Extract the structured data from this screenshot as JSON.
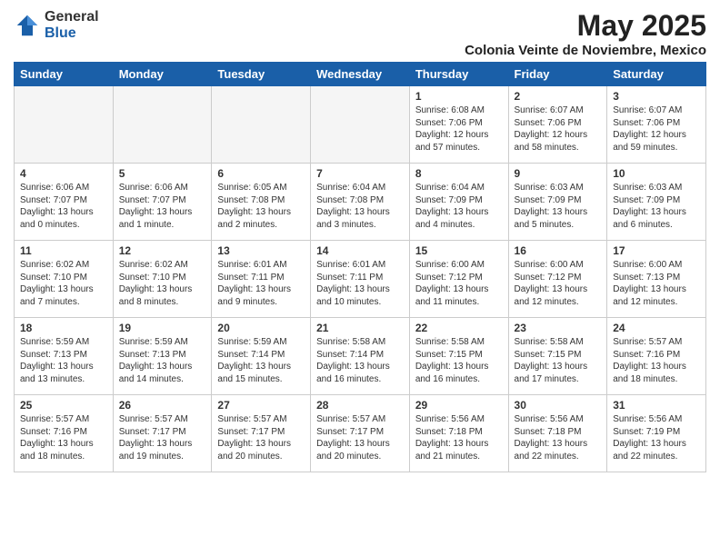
{
  "logo": {
    "general": "General",
    "blue": "Blue"
  },
  "title": {
    "month_year": "May 2025",
    "location": "Colonia Veinte de Noviembre, Mexico"
  },
  "headers": [
    "Sunday",
    "Monday",
    "Tuesday",
    "Wednesday",
    "Thursday",
    "Friday",
    "Saturday"
  ],
  "weeks": [
    [
      {
        "day": "",
        "text": "",
        "empty": true
      },
      {
        "day": "",
        "text": "",
        "empty": true
      },
      {
        "day": "",
        "text": "",
        "empty": true
      },
      {
        "day": "",
        "text": "",
        "empty": true
      },
      {
        "day": "1",
        "text": "Sunrise: 6:08 AM\nSunset: 7:06 PM\nDaylight: 12 hours\nand 57 minutes.",
        "empty": false
      },
      {
        "day": "2",
        "text": "Sunrise: 6:07 AM\nSunset: 7:06 PM\nDaylight: 12 hours\nand 58 minutes.",
        "empty": false
      },
      {
        "day": "3",
        "text": "Sunrise: 6:07 AM\nSunset: 7:06 PM\nDaylight: 12 hours\nand 59 minutes.",
        "empty": false
      }
    ],
    [
      {
        "day": "4",
        "text": "Sunrise: 6:06 AM\nSunset: 7:07 PM\nDaylight: 13 hours\nand 0 minutes.",
        "empty": false
      },
      {
        "day": "5",
        "text": "Sunrise: 6:06 AM\nSunset: 7:07 PM\nDaylight: 13 hours\nand 1 minute.",
        "empty": false
      },
      {
        "day": "6",
        "text": "Sunrise: 6:05 AM\nSunset: 7:08 PM\nDaylight: 13 hours\nand 2 minutes.",
        "empty": false
      },
      {
        "day": "7",
        "text": "Sunrise: 6:04 AM\nSunset: 7:08 PM\nDaylight: 13 hours\nand 3 minutes.",
        "empty": false
      },
      {
        "day": "8",
        "text": "Sunrise: 6:04 AM\nSunset: 7:09 PM\nDaylight: 13 hours\nand 4 minutes.",
        "empty": false
      },
      {
        "day": "9",
        "text": "Sunrise: 6:03 AM\nSunset: 7:09 PM\nDaylight: 13 hours\nand 5 minutes.",
        "empty": false
      },
      {
        "day": "10",
        "text": "Sunrise: 6:03 AM\nSunset: 7:09 PM\nDaylight: 13 hours\nand 6 minutes.",
        "empty": false
      }
    ],
    [
      {
        "day": "11",
        "text": "Sunrise: 6:02 AM\nSunset: 7:10 PM\nDaylight: 13 hours\nand 7 minutes.",
        "empty": false
      },
      {
        "day": "12",
        "text": "Sunrise: 6:02 AM\nSunset: 7:10 PM\nDaylight: 13 hours\nand 8 minutes.",
        "empty": false
      },
      {
        "day": "13",
        "text": "Sunrise: 6:01 AM\nSunset: 7:11 PM\nDaylight: 13 hours\nand 9 minutes.",
        "empty": false
      },
      {
        "day": "14",
        "text": "Sunrise: 6:01 AM\nSunset: 7:11 PM\nDaylight: 13 hours\nand 10 minutes.",
        "empty": false
      },
      {
        "day": "15",
        "text": "Sunrise: 6:00 AM\nSunset: 7:12 PM\nDaylight: 13 hours\nand 11 minutes.",
        "empty": false
      },
      {
        "day": "16",
        "text": "Sunrise: 6:00 AM\nSunset: 7:12 PM\nDaylight: 13 hours\nand 12 minutes.",
        "empty": false
      },
      {
        "day": "17",
        "text": "Sunrise: 6:00 AM\nSunset: 7:13 PM\nDaylight: 13 hours\nand 12 minutes.",
        "empty": false
      }
    ],
    [
      {
        "day": "18",
        "text": "Sunrise: 5:59 AM\nSunset: 7:13 PM\nDaylight: 13 hours\nand 13 minutes.",
        "empty": false
      },
      {
        "day": "19",
        "text": "Sunrise: 5:59 AM\nSunset: 7:13 PM\nDaylight: 13 hours\nand 14 minutes.",
        "empty": false
      },
      {
        "day": "20",
        "text": "Sunrise: 5:59 AM\nSunset: 7:14 PM\nDaylight: 13 hours\nand 15 minutes.",
        "empty": false
      },
      {
        "day": "21",
        "text": "Sunrise: 5:58 AM\nSunset: 7:14 PM\nDaylight: 13 hours\nand 16 minutes.",
        "empty": false
      },
      {
        "day": "22",
        "text": "Sunrise: 5:58 AM\nSunset: 7:15 PM\nDaylight: 13 hours\nand 16 minutes.",
        "empty": false
      },
      {
        "day": "23",
        "text": "Sunrise: 5:58 AM\nSunset: 7:15 PM\nDaylight: 13 hours\nand 17 minutes.",
        "empty": false
      },
      {
        "day": "24",
        "text": "Sunrise: 5:57 AM\nSunset: 7:16 PM\nDaylight: 13 hours\nand 18 minutes.",
        "empty": false
      }
    ],
    [
      {
        "day": "25",
        "text": "Sunrise: 5:57 AM\nSunset: 7:16 PM\nDaylight: 13 hours\nand 18 minutes.",
        "empty": false
      },
      {
        "day": "26",
        "text": "Sunrise: 5:57 AM\nSunset: 7:17 PM\nDaylight: 13 hours\nand 19 minutes.",
        "empty": false
      },
      {
        "day": "27",
        "text": "Sunrise: 5:57 AM\nSunset: 7:17 PM\nDaylight: 13 hours\nand 20 minutes.",
        "empty": false
      },
      {
        "day": "28",
        "text": "Sunrise: 5:57 AM\nSunset: 7:17 PM\nDaylight: 13 hours\nand 20 minutes.",
        "empty": false
      },
      {
        "day": "29",
        "text": "Sunrise: 5:56 AM\nSunset: 7:18 PM\nDaylight: 13 hours\nand 21 minutes.",
        "empty": false
      },
      {
        "day": "30",
        "text": "Sunrise: 5:56 AM\nSunset: 7:18 PM\nDaylight: 13 hours\nand 22 minutes.",
        "empty": false
      },
      {
        "day": "31",
        "text": "Sunrise: 5:56 AM\nSunset: 7:19 PM\nDaylight: 13 hours\nand 22 minutes.",
        "empty": false
      }
    ]
  ]
}
